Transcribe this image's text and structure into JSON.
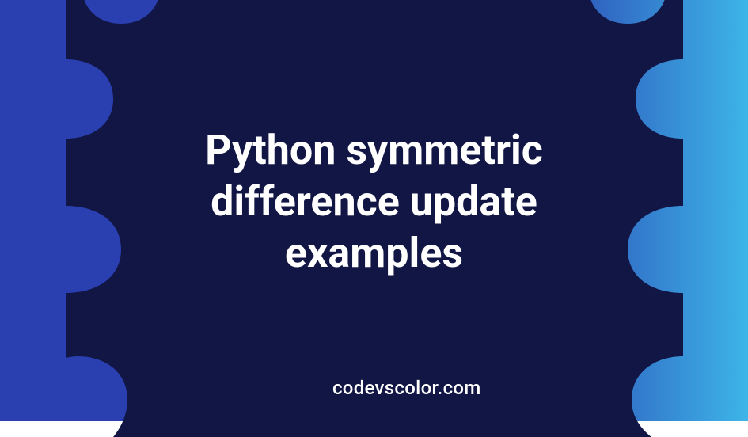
{
  "title": "Python symmetric difference update examples",
  "site": "codevscolor.com",
  "colors": {
    "bg_left": "#2a3fb0",
    "bg_right": "#3db5e8",
    "blob": "#121644",
    "text": "#ffffff"
  }
}
